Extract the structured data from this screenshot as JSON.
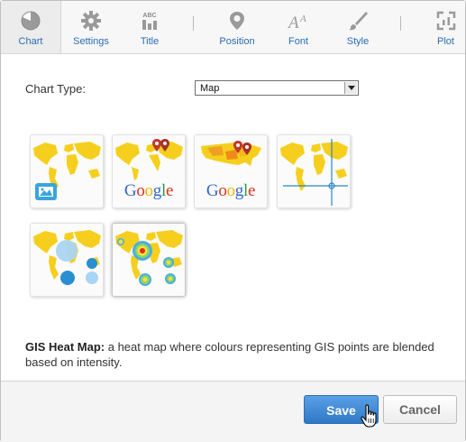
{
  "toolbar": {
    "items": [
      {
        "label": "Chart",
        "icon": "pie-chart-icon"
      },
      {
        "label": "Settings",
        "icon": "gear-icon"
      },
      {
        "label": "Title",
        "icon": "title-icon"
      },
      {
        "label": "Position",
        "icon": "map-pin-icon"
      },
      {
        "label": "Font",
        "icon": "font-icon"
      },
      {
        "label": "Style",
        "icon": "brush-icon"
      },
      {
        "label": "Plot",
        "icon": "plot-icon"
      }
    ],
    "title_icon_text": "ABC"
  },
  "chart_type": {
    "label": "Chart Type:",
    "selected": "Map"
  },
  "thumbnails": [
    {
      "name": "map-image-thumb"
    },
    {
      "name": "google-pin-map-thumb",
      "logo": "Google"
    },
    {
      "name": "google-usa-map-thumb",
      "logo": "Google"
    },
    {
      "name": "crosshair-map-thumb"
    },
    {
      "name": "bubble-map-thumb"
    },
    {
      "name": "gis-heat-map-thumb",
      "selected": true
    }
  ],
  "description": {
    "title": "GIS Heat Map:",
    "text": " a heat map where colours representing GIS points are blended based on intensity."
  },
  "buttons": {
    "save": "Save",
    "cancel": "Cancel"
  },
  "colors": {
    "accent": "#2a6db5",
    "map_yellow": "#f6cf1e",
    "save_button": "#3a84d0",
    "google_blue": "#3366cc",
    "google_red": "#d6321e",
    "google_yellow": "#f0b400",
    "google_green": "#2f9a3a"
  }
}
